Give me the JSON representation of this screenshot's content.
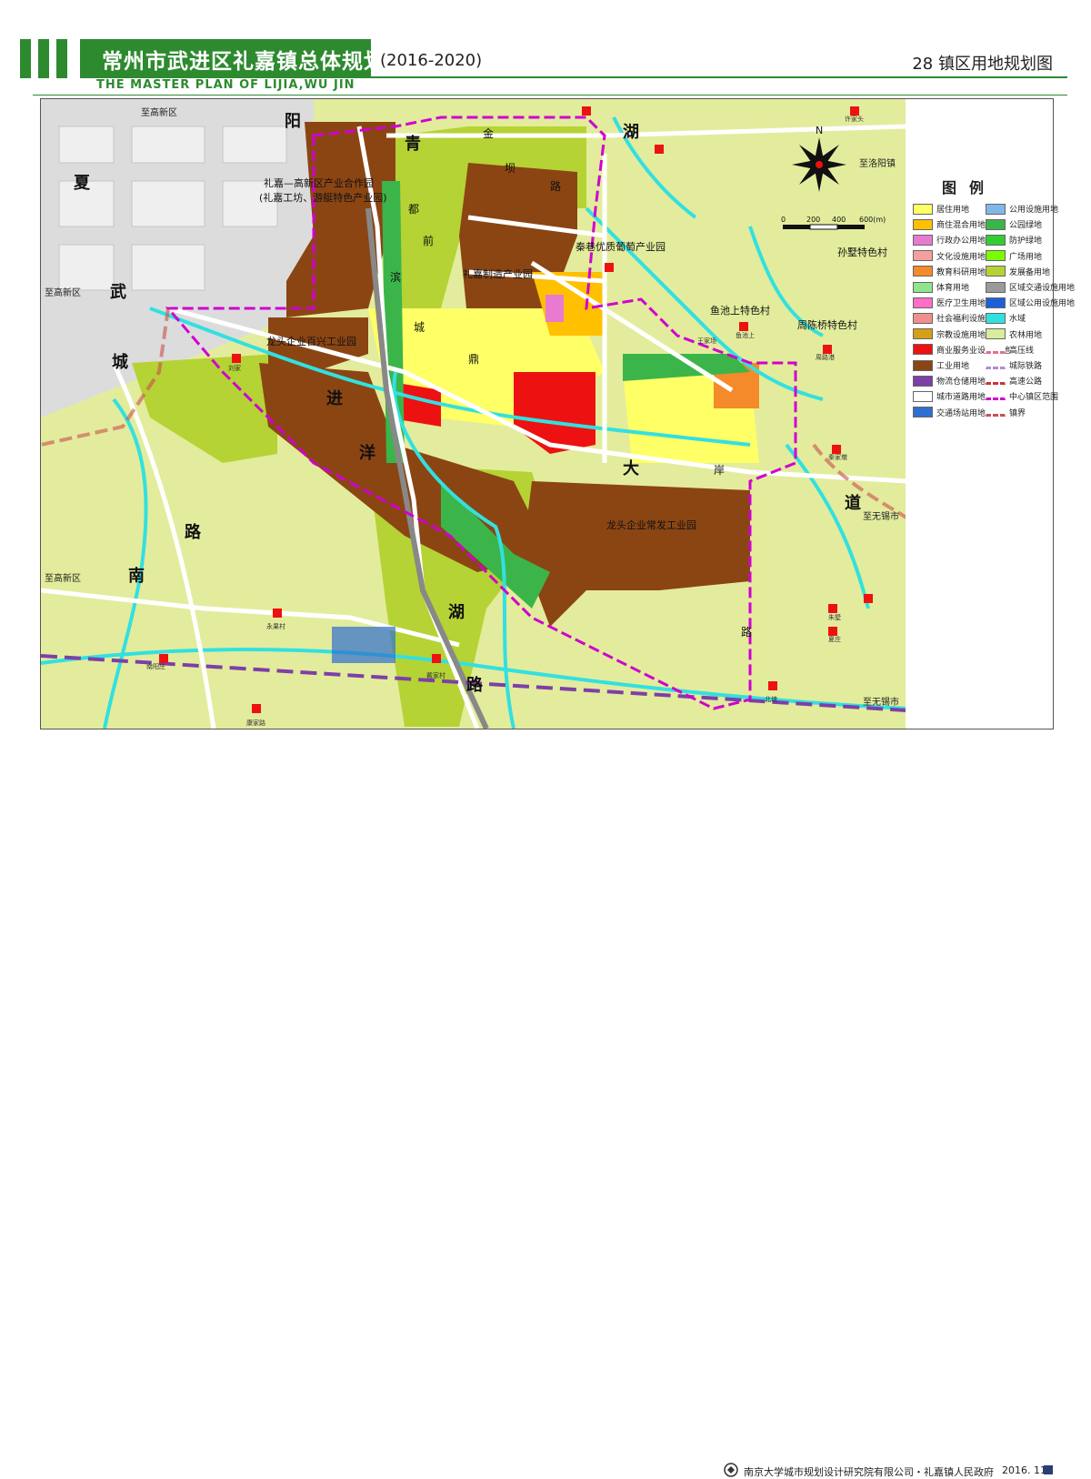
{
  "header": {
    "title_cn": "常州市武进区礼嘉镇总体规划",
    "years": "(2016-2020)",
    "title_en": "THE MASTER PLAN OF LIJIA,WU JIN",
    "map_name": "28 镇区用地规划图"
  },
  "map": {
    "road_names": [
      "阳",
      "青",
      "湖",
      "夏",
      "武",
      "城",
      "进",
      "洋",
      "大",
      "道",
      "南",
      "湖",
      "路",
      "路",
      "金",
      "坝",
      "路",
      "都",
      "前",
      "滨",
      "城",
      "鼎",
      "岸",
      "路"
    ],
    "area_labels": {
      "park1_line1": "礼嘉—高新区产业合作园",
      "park1_line2": "(礼嘉工坊、游艇特色产业园)",
      "grape_park": "秦巷优质葡萄产业园",
      "manufacturing_park": "礼嘉制造产业园",
      "baixing_park": "龙头企业百兴工业园",
      "changfa_park": "龙头企业常发工业园",
      "sunshu_village": "孙墅特色村",
      "yuchi_village": "鱼池上特色村",
      "zhoumiaoqiao_village": "周陈桥特色村"
    },
    "directions": {
      "to_gaoxin_1": "至高新区",
      "to_gaoxin_2": "至高新区",
      "to_gaoxin_3": "至高新区",
      "to_luoyang": "至洛阳镇",
      "to_wuxi_1": "至无锡市",
      "to_wuxi_2": "至无锡市"
    },
    "village_names": [
      "永果村",
      "南阳庄",
      "戴家村",
      "康家路",
      "北塘",
      "许家头",
      "秦家墩",
      "夏庄",
      "朱墅",
      "周路港",
      "刘家",
      "王家场",
      "鱼池上"
    ],
    "compass": {
      "north": "N"
    },
    "scale": {
      "ticks": [
        "0",
        "200",
        "400",
        "600(m)"
      ]
    }
  },
  "legend": {
    "title": "图例",
    "items": [
      {
        "label": "居住用地",
        "color": "#ffff66",
        "line": false
      },
      {
        "label": "公用设施用地",
        "color": "#7fb8e8",
        "line": false
      },
      {
        "label": "商住混合用地",
        "color": "#ffc000",
        "line": false
      },
      {
        "label": "公园绿地",
        "color": "#3bb54a",
        "line": false
      },
      {
        "label": "行政办公用地",
        "color": "#e87ad0",
        "line": false
      },
      {
        "label": "防护绿地",
        "color": "#32cd32",
        "line": false
      },
      {
        "label": "文化设施用地",
        "color": "#f5a0a0",
        "line": false
      },
      {
        "label": "广场用地",
        "color": "#7cfc00",
        "line": false
      },
      {
        "label": "教育科研用地",
        "color": "#f48a2a",
        "line": false
      },
      {
        "label": "发展备用地",
        "color": "#b5d334",
        "line": false
      },
      {
        "label": "体育用地",
        "color": "#8ee58c",
        "line": false
      },
      {
        "label": "区域交通设施用地",
        "color": "#9a9a9a",
        "line": false
      },
      {
        "label": "医疗卫生用地",
        "color": "#ff6ec7",
        "line": false
      },
      {
        "label": "区域公用设施用地",
        "color": "#1e5fd8",
        "line": false
      },
      {
        "label": "社会福利设施用地",
        "color": "#f28e8e",
        "line": false
      },
      {
        "label": "水域",
        "color": "#33e0e0",
        "line": false
      },
      {
        "label": "宗教设施用地",
        "color": "#d4a017",
        "line": false
      },
      {
        "label": "农林用地",
        "color": "#d8ec9c",
        "line": false
      },
      {
        "label": "商业服务业设施用地",
        "color": "#ee1111",
        "line": false
      },
      {
        "label": "高压线",
        "color": "#e07090",
        "line": true
      },
      {
        "label": "工业用地",
        "color": "#8b4513",
        "line": false
      },
      {
        "label": "城际铁路",
        "color": "#b18ad6",
        "line": true
      },
      {
        "label": "物流仓储用地",
        "color": "#7d3fa8",
        "line": false
      },
      {
        "label": "高速公路",
        "color": "#cc3333",
        "line": true
      },
      {
        "label": "城市道路用地",
        "color": "#ffffff",
        "line": false
      },
      {
        "label": "中心镇区范围",
        "color": "#d000d0",
        "line": true
      },
      {
        "label": "交通场站用地",
        "color": "#2e6fcf",
        "line": false
      },
      {
        "label": "镇界",
        "color": "#c85050",
        "line": true
      }
    ]
  },
  "footer": {
    "org": "南京大学城市规划设计研究院有限公司・礼嘉镇人民政府",
    "date": "2016. 11"
  }
}
